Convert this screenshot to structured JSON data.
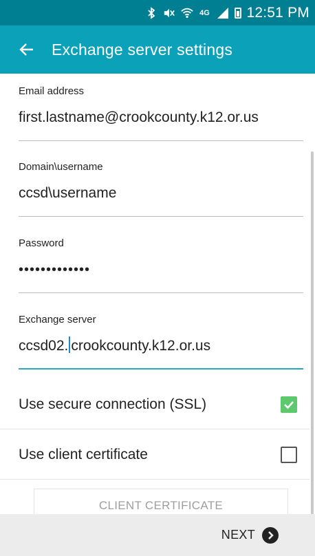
{
  "status_bar": {
    "time": "12:51 PM",
    "network": "4G"
  },
  "app_bar": {
    "title": "Exchange server settings",
    "back_icon": "arrow-left-icon"
  },
  "form": {
    "email": {
      "label": "Email address",
      "value": "first.lastname@crookcounty.k12.or.us"
    },
    "domain_username": {
      "label": "Domain\\username",
      "value": "ccsd\\username"
    },
    "password": {
      "label": "Password",
      "value": "•••••••••••••"
    },
    "exchange_server": {
      "label": "Exchange server",
      "value_before_cursor": "ccsd02.",
      "value_after_cursor": "crookcounty.k12.or.us"
    }
  },
  "options": {
    "ssl": {
      "label": "Use secure connection (SSL)",
      "checked": true
    },
    "client_cert": {
      "label": "Use client certificate",
      "checked": false
    }
  },
  "client_certificate_button": "CLIENT CERTIFICATE",
  "footer": {
    "next_label": "NEXT",
    "next_icon": "chevron-right-circle-icon"
  },
  "colors": {
    "status_bar": "#007f93",
    "app_bar": "#0aa1b9",
    "checkbox_checked": "#5cc96e",
    "focus_underline": "#29a5c6"
  }
}
